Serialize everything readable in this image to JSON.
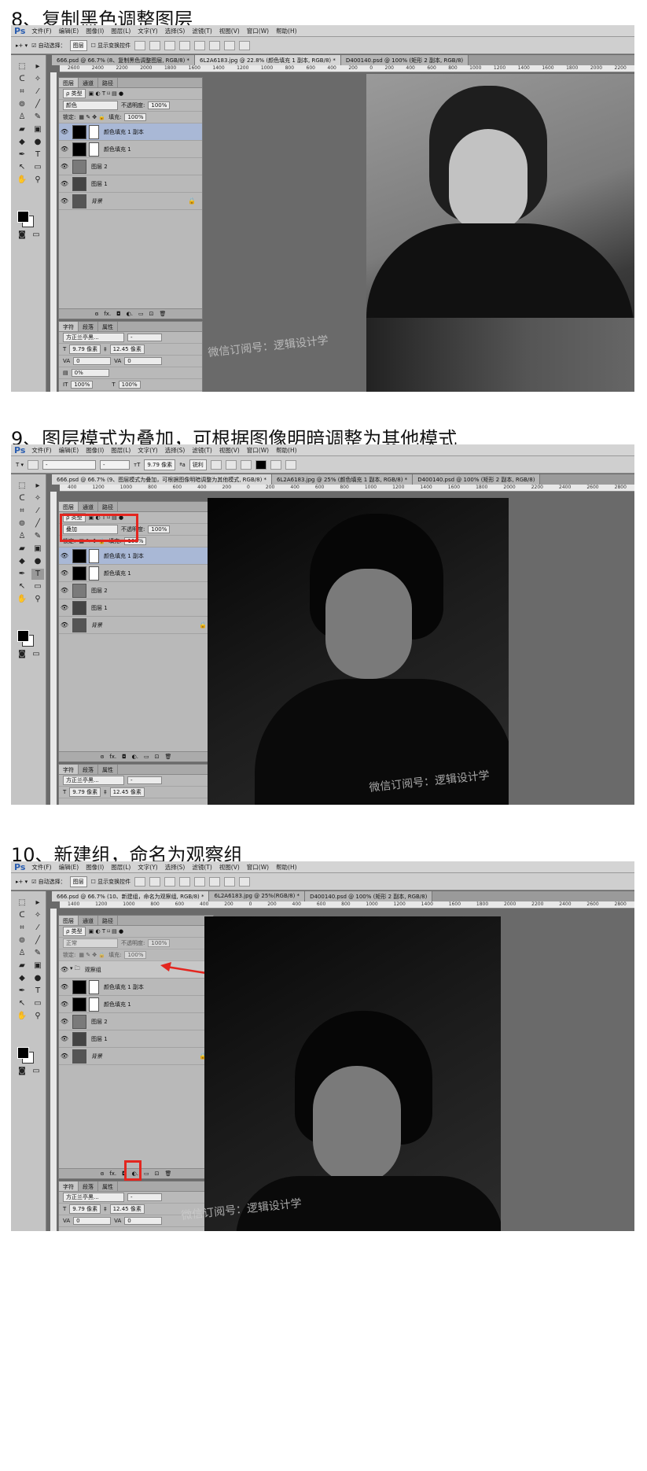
{
  "steps": [
    {
      "title": "8、复制黑色调整图层",
      "menu": [
        "文件(F)",
        "编辑(E)",
        "图像(I)",
        "图层(L)",
        "文字(Y)",
        "选择(S)",
        "滤镜(T)",
        "视图(V)",
        "窗口(W)",
        "帮助(H)"
      ],
      "options": {
        "auto_select": "自动选择：",
        "select_value": "图层",
        "show_transform": "显示变换控件"
      },
      "tabs": [
        "666.psd @ 66.7% (8、复制黑色调整图层, RGB/8) *",
        "6L2A6183.jpg @ 22.8% (颜色填充 1 副本, RGB/8) *",
        "D400140.psd @ 100% (矩形 2 副本, RGB/8)"
      ],
      "ruler": [
        "2600",
        "2400",
        "2200",
        "2000",
        "1800",
        "1600",
        "1400",
        "1200",
        "1000",
        "800",
        "600",
        "400",
        "200",
        "0",
        "200",
        "400",
        "600",
        "800",
        "1000",
        "1200",
        "1400",
        "1600",
        "1800",
        "2000",
        "2200"
      ],
      "layers_panel": {
        "tabs": [
          "图层",
          "通道",
          "路径"
        ],
        "kind_label": "ρ 类型",
        "blend_mode": "颜色",
        "opacity_label": "不透明度:",
        "opacity_value": "100%",
        "lock_label": "锁定:",
        "fill_label": "填充:",
        "fill_value": "100%",
        "layers": [
          {
            "name": "颜色填充 1 副本",
            "selected": true
          },
          {
            "name": "颜色填充 1",
            "selected": false
          },
          {
            "name": "图层 2",
            "selected": false
          },
          {
            "name": "图层 1",
            "selected": false
          },
          {
            "name": "背景",
            "selected": false
          }
        ],
        "footer": [
          "ɞ",
          "fx.",
          "◘",
          "◐.",
          "▭",
          "⊡",
          "🗑"
        ]
      },
      "char_panel": {
        "tabs": [
          "字符",
          "段落",
          "属性"
        ],
        "font": "方正兰亭黑...",
        "size": "9.79 像素",
        "leading": "12.45 像素",
        "tracking_va": "0",
        "tracking": "0",
        "scale_pct": "0%",
        "v_scale": "100%",
        "h_scale": "100%"
      },
      "watermark": "微信订阅号：逻辑设计学"
    },
    {
      "title": "9、图层模式为叠加，可根据图像明暗调整为其他模式",
      "menu": [
        "文件(F)",
        "编辑(E)",
        "图像(I)",
        "图层(L)",
        "文字(Y)",
        "选择(S)",
        "滤镜(T)",
        "视图(V)",
        "窗口(W)",
        "帮助(H)"
      ],
      "options": {
        "font_size": "9.79 像素",
        "aa_label": "ªa",
        "aa_value": "锐利"
      },
      "tabs": [
        "666.psd @ 66.7% (9、图层模式为叠加，可根据图像明暗调整为其他模式, RGB/8) *",
        "6L2A6183.jpg @ 25% (颜色填充 1 副本, RGB/8) *",
        "D400140.psd @ 100% (矩形 2 副本, RGB/8)"
      ],
      "ruler": [
        "400",
        "1200",
        "1000",
        "800",
        "600",
        "400",
        "200",
        "0",
        "200",
        "400",
        "600",
        "800",
        "1000",
        "1200",
        "1400",
        "1600",
        "1800",
        "2000",
        "2200",
        "2400",
        "2600",
        "2800"
      ],
      "layers_panel": {
        "tabs": [
          "图层",
          "通道",
          "路径"
        ],
        "kind_label": "ρ 类型",
        "blend_mode": "叠加",
        "opacity_label": "不透明度:",
        "opacity_value": "100%",
        "lock_label": "锁定:",
        "fill_label": "填充:",
        "fill_value": "100%",
        "layers": [
          {
            "name": "颜色填充 1 副本",
            "selected": true
          },
          {
            "name": "颜色填充 1",
            "selected": false
          },
          {
            "name": "图层 2",
            "selected": false
          },
          {
            "name": "图层 1",
            "selected": false
          },
          {
            "name": "背景",
            "selected": false
          }
        ],
        "footer": [
          "ɞ",
          "fx.",
          "◘",
          "◐.",
          "▭",
          "⊡",
          "🗑"
        ]
      },
      "char_panel": {
        "tabs": [
          "字符",
          "段落",
          "属性"
        ],
        "font": "方正兰亭黑...",
        "size": "9.79 像素",
        "leading": "12.45 像素",
        "tracking_va": "0",
        "tracking": "0"
      },
      "watermark": "微信订阅号：逻辑设计学"
    },
    {
      "title": "10、新建组，命名为观察组",
      "menu": [
        "文件(F)",
        "编辑(E)",
        "图像(I)",
        "图层(L)",
        "文字(Y)",
        "选择(S)",
        "滤镜(T)",
        "视图(V)",
        "窗口(W)",
        "帮助(H)"
      ],
      "options": {
        "auto_select": "自动选择：",
        "select_value": "图层",
        "show_transform": "显示变换控件"
      },
      "tabs": [
        "666.psd @ 66.7% (10、新建组，命名为观察组, RGB/8) *",
        "6L2A6183.jpg @ 25%(RGB/8) *",
        "D400140.psd @ 100% (矩形 2 副本, RGB/8)"
      ],
      "ruler": [
        "1400",
        "1200",
        "1000",
        "800",
        "600",
        "400",
        "200",
        "0",
        "200",
        "400",
        "600",
        "800",
        "1000",
        "1200",
        "1400",
        "1600",
        "1800",
        "2000",
        "2200",
        "2400",
        "2600",
        "2800"
      ],
      "layers_panel": {
        "tabs": [
          "图层",
          "通道",
          "路径"
        ],
        "kind_label": "ρ 类型",
        "blend_mode": "正常",
        "opacity_label": "不透明度:",
        "opacity_value": "100%",
        "lock_label": "锁定:",
        "fill_label": "填充:",
        "fill_value": "100%",
        "group_name": "观察组",
        "layers": [
          {
            "name": "颜色填充 1 副本",
            "selected": false
          },
          {
            "name": "颜色填充 1",
            "selected": false
          },
          {
            "name": "图层 2",
            "selected": false
          },
          {
            "name": "图层 1",
            "selected": false
          },
          {
            "name": "背景",
            "selected": false
          }
        ],
        "footer": [
          "ɞ",
          "fx.",
          "◘",
          "◐.",
          "▭",
          "⊡",
          "🗑"
        ]
      },
      "char_panel": {
        "tabs": [
          "字符",
          "段落",
          "属性"
        ],
        "font": "方正兰亭黑...",
        "size": "9.79 像素",
        "leading": "12.45 像素",
        "tracking_va": "0",
        "tracking": "0"
      },
      "watermark": "微信订阅号：逻辑设计学"
    }
  ],
  "colors": {
    "highlight_red": "#e3261f",
    "selected_layer": "#a9b8d6",
    "ps_blue": "#2a5db0"
  }
}
